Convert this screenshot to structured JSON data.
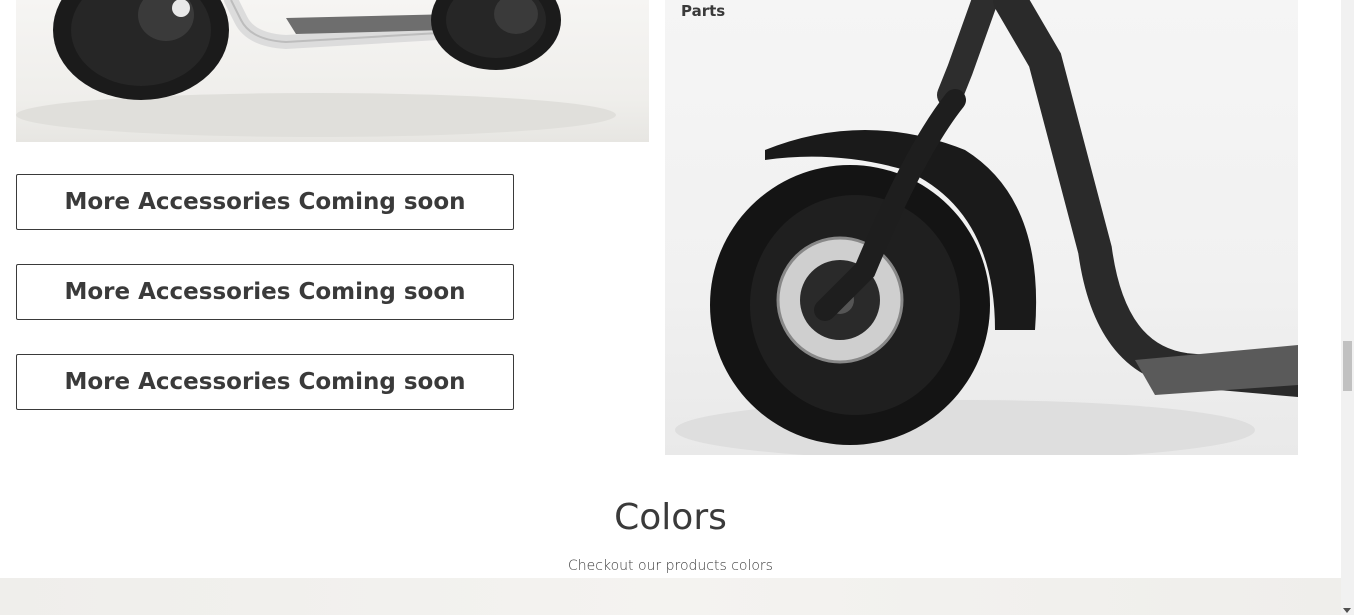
{
  "parts": {
    "label": "Parts"
  },
  "accessories": {
    "buttons": [
      "More Accessories Coming soon",
      "More Accessories Coming soon",
      "More Accessories Coming soon"
    ]
  },
  "colors_section": {
    "title": "Colors",
    "subtitle": "Checkout our products colors"
  }
}
